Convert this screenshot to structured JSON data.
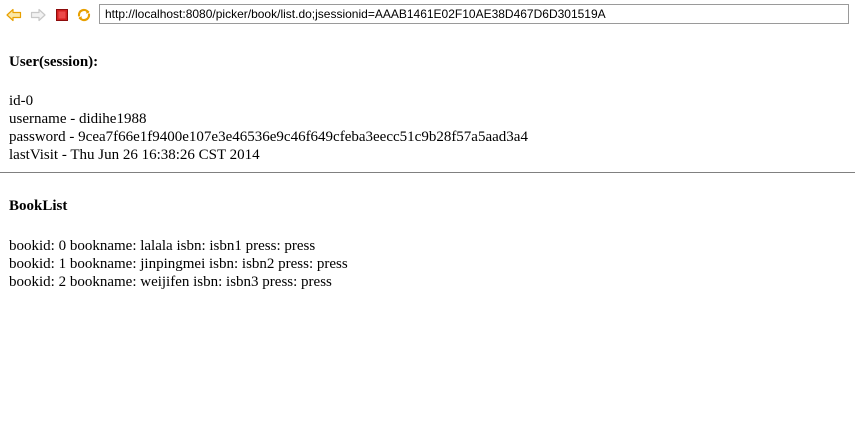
{
  "browser": {
    "address": "http://localhost:8080/picker/book/list.do;jsessionid=AAAB1461E02F10AE38D467D6D301519A",
    "icons": {
      "back": "arrow-left-icon",
      "forward": "arrow-right-icon",
      "stop": "stop-icon",
      "refresh": "refresh-icon"
    },
    "colors": {
      "back": "#e8a000",
      "forward": "#c8c8c8",
      "stop": "#d42020",
      "refresh": "#e8a000"
    }
  },
  "user": {
    "heading": "User(session):",
    "lines": [
      "id-0",
      "username - didihe1988",
      "password - 9cea7f66e1f9400e107e3e46536e9c46f649cfeba3eecc51c9b28f57a5aad3a4",
      "lastVisit - Thu Jun 26 16:38:26 CST 2014"
    ]
  },
  "books": {
    "heading": "BookList",
    "items": [
      "bookid: 0 bookname: lalala isbn: isbn1 press: press",
      "bookid: 1 bookname: jinpingmei isbn: isbn2 press: press",
      "bookid: 2 bookname: weijifen isbn: isbn3 press: press"
    ]
  }
}
